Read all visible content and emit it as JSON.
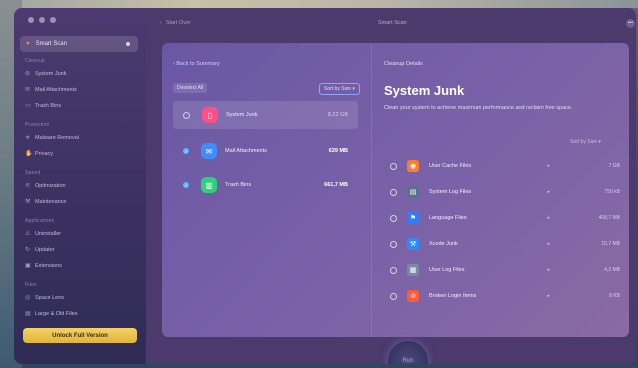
{
  "window": {
    "header_nav": "Start Over",
    "header_title": "Smart Scan"
  },
  "sidebar": {
    "current": "Smart Scan",
    "sections": [
      {
        "title": "Cleanup",
        "items": [
          {
            "label": "System Junk",
            "icon": "trash-icon"
          },
          {
            "label": "Mail Attachments",
            "icon": "mail-icon"
          },
          {
            "label": "Trash Bins",
            "icon": "bin-icon"
          }
        ]
      },
      {
        "title": "Protection",
        "items": [
          {
            "label": "Malware Removal",
            "icon": "biohazard-icon"
          },
          {
            "label": "Privacy",
            "icon": "hand-icon"
          }
        ]
      },
      {
        "title": "Speed",
        "items": [
          {
            "label": "Optimization",
            "icon": "sliders-icon"
          },
          {
            "label": "Maintenance",
            "icon": "wrench-icon"
          }
        ]
      },
      {
        "title": "Applications",
        "items": [
          {
            "label": "Uninstaller",
            "icon": "uninstall-icon"
          },
          {
            "label": "Updater",
            "icon": "refresh-icon"
          },
          {
            "label": "Extensions",
            "icon": "puzzle-icon"
          }
        ]
      },
      {
        "title": "Files",
        "items": [
          {
            "label": "Space Lens",
            "icon": "lens-icon"
          },
          {
            "label": "Large & Old Files",
            "icon": "folder-icon"
          }
        ]
      }
    ],
    "unlock_label": "Unlock Full Version"
  },
  "panel": {
    "back_label": "Back to Summary",
    "cleanup_label": "Cleanup Details",
    "deselect_label": "Deselect All",
    "sort_label": "Sort by Size",
    "categories": [
      {
        "name": "System Junk",
        "size": "8,22 GB",
        "checked": false,
        "selected": true,
        "color": "#ff4f8b",
        "icon": "trash-can-icon"
      },
      {
        "name": "Mail Attachments",
        "size": "639 MB",
        "checked": true,
        "selected": false,
        "color": "#3f8cff",
        "icon": "mail-attachment-icon"
      },
      {
        "name": "Trash Bins",
        "size": "661,7 MB",
        "checked": true,
        "selected": false,
        "color": "#2fd07a",
        "icon": "trash-bin-icon"
      }
    ],
    "detail": {
      "title": "System Junk",
      "description": "Clean your system to achieve maximum performance and reclaim free space.",
      "sort_label": "Sort by Size",
      "items": [
        {
          "label": "User Cache Files",
          "size": "7 GB",
          "color": "#ff7b2e",
          "icon": "cache-icon"
        },
        {
          "label": "System Log Files",
          "size": "750 kB",
          "color": "#5a6f8c",
          "icon": "log-icon"
        },
        {
          "label": "Language Files",
          "size": "408,7 MB",
          "color": "#2f7cff",
          "icon": "flag-icon"
        },
        {
          "label": "Xcode Junk",
          "size": "15,7 MB",
          "color": "#2e8bff",
          "icon": "xcode-icon"
        },
        {
          "label": "User Log Files",
          "size": "4,2 MB",
          "color": "#7a8aa6",
          "icon": "user-log-icon"
        },
        {
          "label": "Broken Login Items",
          "size": "8 KB",
          "color": "#ff5a3c",
          "icon": "broken-login-icon"
        }
      ]
    }
  },
  "run_label": "Run"
}
